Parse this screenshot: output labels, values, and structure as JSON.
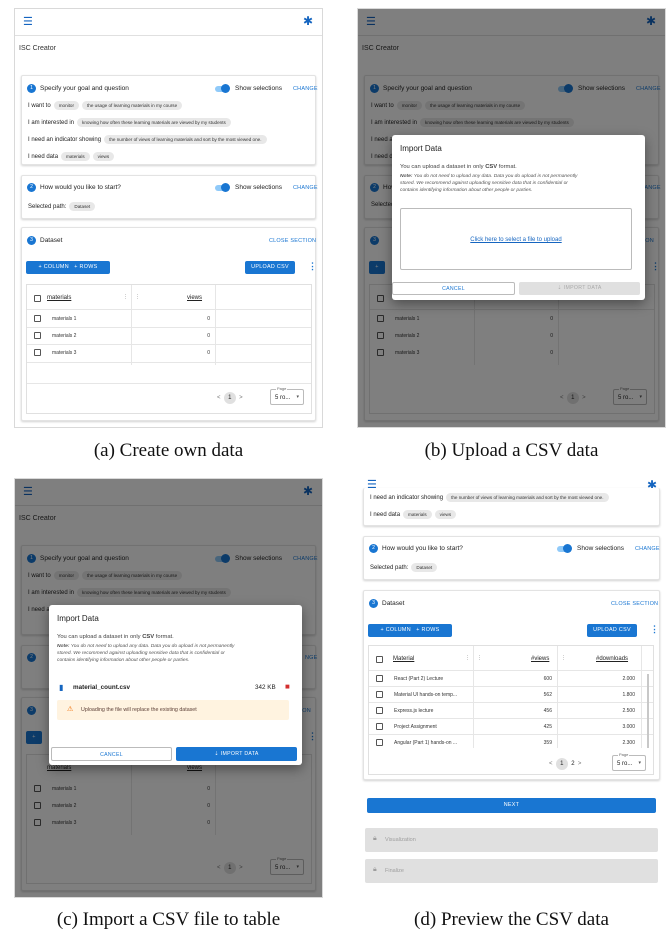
{
  "app": {
    "title": "ISC Creator"
  },
  "goal": {
    "step_number": "1",
    "title": "Specify your goal and question",
    "show_label": "Show selections",
    "change_label": "CHANGE",
    "rows": [
      {
        "label": "I want to",
        "chips": [
          "monitor",
          "the usage of learning materials in my course"
        ]
      },
      {
        "label": "I am interested in",
        "chips": [
          "knowing how often these learning materials are viewed by my students"
        ]
      },
      {
        "label": "I need an indicator showing",
        "chips": [
          "the number of views of learning materials and sort by the most viewed one."
        ]
      },
      {
        "label": "I need data",
        "chips": [
          "materials",
          "views"
        ]
      }
    ]
  },
  "start": {
    "step_number": "2",
    "title": "How would you like to start?",
    "show_label": "Show selections",
    "change_label": "CHANGE",
    "path_label": "Selected path:",
    "path_value": "Dataset"
  },
  "dataset": {
    "step_number": "3",
    "title": "Dataset",
    "close_label": "CLOSE SECTION",
    "add_column": "+ COLUMN",
    "add_rows": "+ ROWS",
    "upload_csv": "UPLOAD CSV",
    "kebab": "⋮"
  },
  "table_a": {
    "headers": [
      "materials",
      "views"
    ],
    "rows": [
      [
        "materials 1",
        "0"
      ],
      [
        "materials 2",
        "0"
      ],
      [
        "materials 3",
        "0"
      ]
    ],
    "page": "1",
    "page_label": "Page",
    "page_size": "5 ro..."
  },
  "dialog_b": {
    "title": "Import Data",
    "intro_prefix": "You can upload a dataset in only ",
    "intro_bold": "CSV",
    "intro_suffix": " format.",
    "note_label": "Note:",
    "note_l1": "You do not need to upload any data. Data you do upload is not permanently",
    "note_l2": "stored. We recommend against uploading sensitive data that is confidential or",
    "note_l3": "contains identifying information about other people or parties.",
    "drop_text": "Click here to select a file to upload",
    "cancel": "CANCEL",
    "import": "IMPORT DATA"
  },
  "dialog_c": {
    "file_name": "material_count.csv",
    "file_size": "342 KB",
    "warning": "Uploading the file will replace the existing dataset"
  },
  "table_d": {
    "headers": [
      "Material",
      "#views",
      "#downloads"
    ],
    "rows": [
      [
        "React (Part 2) Lecture",
        "600",
        "2.000"
      ],
      [
        "Material UI hands-on temp...",
        "562",
        "1.800"
      ],
      [
        "Express.js lecture",
        "456",
        "2.500"
      ],
      [
        "Project Assignment",
        "425",
        "3.000"
      ],
      [
        "Angular (Part 1) hands-on ...",
        "359",
        "2.300"
      ]
    ],
    "pages": [
      "1",
      "2"
    ],
    "page_label": "Page",
    "page_size": "5 ro...",
    "next": "NEXT",
    "visualization": "Visualization",
    "finalize": "Finalize"
  },
  "captions": {
    "a": "(a) Create own data",
    "b": "(b) Upload a CSV data",
    "c": "(c) Import a CSV file to table",
    "d": "(d) Preview the CSV data"
  },
  "icons": {
    "menu": "menu-icon",
    "settings": "gear-icon",
    "file": "file-icon",
    "delete": "delete-icon",
    "warning": "warning-icon",
    "lock": "lock-icon",
    "upload": "upload-icon"
  },
  "colors": {
    "primary": "#1976d2",
    "warning_bg": "#fff3e0",
    "delete": "#d32f2f"
  }
}
